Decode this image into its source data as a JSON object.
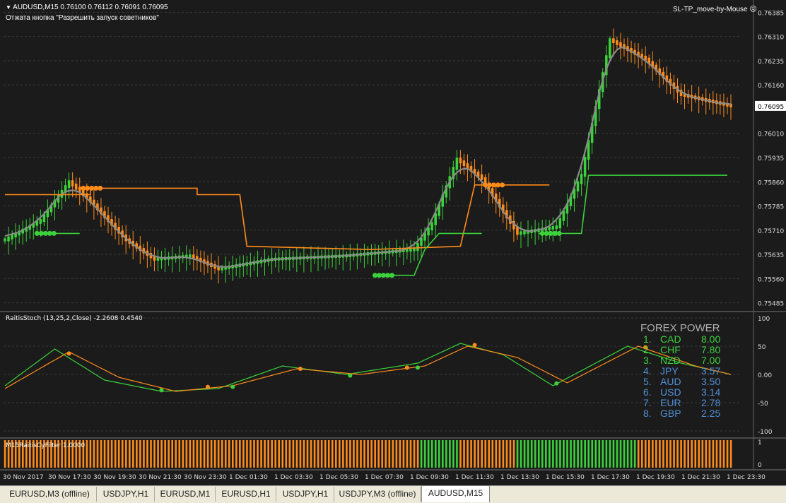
{
  "header": {
    "symbol_line": "AUDUSD,M15  0.76100 0.76112 0.76091 0.76095",
    "notice": "Отжата кнопка \"Разрешить запуск советников\"",
    "expert_name": "SL-TP_move-by-Mouse"
  },
  "colors": {
    "bg": "#1b1b1b",
    "grid": "#3a3a3a",
    "bull": "#3bd23b",
    "bear": "#ff8c1a",
    "ma": "#8a8a8a",
    "forex_title": "#b0b0b0",
    "rank_green": "#3bd23b",
    "rank_blue": "#4f8fd6"
  },
  "chart_data": [
    {
      "type": "candlestick",
      "name": "AUDUSD,M15",
      "ylim": [
        0.7546,
        0.7641
      ],
      "y_ticks": [
        "0.76385",
        "0.76310",
        "0.76235",
        "0.76160",
        "0.76095",
        "0.76010",
        "0.75935",
        "0.75860",
        "0.75785",
        "0.75710",
        "0.75635",
        "0.75560",
        "0.75485"
      ],
      "current_price": "0.76095",
      "bars": 205,
      "key_closes": [
        [
          0,
          0.7568
        ],
        [
          10,
          0.7574
        ],
        [
          18,
          0.7586
        ],
        [
          24,
          0.758
        ],
        [
          34,
          0.7568
        ],
        [
          42,
          0.7562
        ],
        [
          52,
          0.7563
        ],
        [
          60,
          0.7559
        ],
        [
          75,
          0.7562
        ],
        [
          95,
          0.7563
        ],
        [
          115,
          0.7565
        ],
        [
          120,
          0.7573
        ],
        [
          127,
          0.7593
        ],
        [
          134,
          0.7587
        ],
        [
          144,
          0.757
        ],
        [
          155,
          0.7572
        ],
        [
          162,
          0.7588
        ],
        [
          170,
          0.763
        ],
        [
          180,
          0.7624
        ],
        [
          190,
          0.7613
        ],
        [
          204,
          0.76095
        ]
      ],
      "resistance_line": [
        [
          0,
          0.7582
        ],
        [
          24,
          0.7582
        ],
        [
          24,
          0.7584
        ],
        [
          54,
          0.7584
        ],
        [
          54,
          0.7582
        ],
        [
          66,
          0.7582
        ],
        [
          68,
          0.7566
        ],
        [
          103,
          0.7565
        ],
        [
          128,
          0.7566
        ],
        [
          132,
          0.7585
        ],
        [
          153,
          0.7585
        ]
      ],
      "support_line": [
        [
          9,
          0.757
        ],
        [
          21,
          0.757
        ]
      ],
      "support_line_2": [
        [
          105,
          0.7557
        ],
        [
          115,
          0.7557
        ],
        [
          118,
          0.7565
        ],
        [
          122,
          0.757
        ],
        [
          134,
          0.757
        ]
      ],
      "support_line_3": [
        [
          150,
          0.757
        ],
        [
          162,
          0.757
        ],
        [
          164,
          0.7588
        ],
        [
          203,
          0.7588
        ]
      ]
    },
    {
      "type": "line",
      "title": "RaitisStoch (13,25,2,Close) -2.2608 0.4540",
      "ylim": [
        -110,
        110
      ],
      "y_ticks": [
        "100",
        "50",
        "0.00",
        "-50",
        "-100"
      ],
      "series": [
        {
          "name": "green",
          "points": [
            [
              0,
              -20
            ],
            [
              14,
              45
            ],
            [
              28,
              -10
            ],
            [
              44,
              -30
            ],
            [
              60,
              -25
            ],
            [
              78,
              15
            ],
            [
              96,
              0
            ],
            [
              116,
              20
            ],
            [
              128,
              55
            ],
            [
              140,
              35
            ],
            [
              154,
              -20
            ],
            [
              175,
              50
            ],
            [
              190,
              20
            ],
            [
              204,
              0
            ]
          ]
        },
        {
          "name": "orange",
          "points": [
            [
              0,
              -25
            ],
            [
              18,
              40
            ],
            [
              32,
              -5
            ],
            [
              48,
              -30
            ],
            [
              64,
              -20
            ],
            [
              82,
              10
            ],
            [
              100,
              0
            ],
            [
              118,
              15
            ],
            [
              130,
              50
            ],
            [
              144,
              30
            ],
            [
              158,
              -15
            ],
            [
              178,
              50
            ],
            [
              194,
              15
            ],
            [
              204,
              0
            ]
          ]
        }
      ],
      "markers": [
        {
          "x": 18,
          "y": 37,
          "color": "orange"
        },
        {
          "x": 44,
          "y": -28,
          "color": "green"
        },
        {
          "x": 57,
          "y": -22,
          "color": "orange"
        },
        {
          "x": 64,
          "y": -22,
          "color": "green"
        },
        {
          "x": 83,
          "y": 10,
          "color": "orange"
        },
        {
          "x": 97,
          "y": -2,
          "color": "green"
        },
        {
          "x": 113,
          "y": 12,
          "color": "orange"
        },
        {
          "x": 116,
          "y": 12,
          "color": "green"
        },
        {
          "x": 132,
          "y": 52,
          "color": "orange"
        },
        {
          "x": 155,
          "y": -16,
          "color": "green"
        },
        {
          "x": 180,
          "y": 48,
          "color": "orange"
        }
      ]
    },
    {
      "type": "bar",
      "title": "M15RaitisCyFilter 1.0000",
      "ylim": [
        0,
        1
      ],
      "y_ticks": [
        "1",
        "0"
      ],
      "green_ranges": [
        [
          117,
          127
        ],
        [
          144,
          177
        ]
      ]
    }
  ],
  "x_axis": {
    "labels": [
      "30 Nov 2017",
      "30 Nov 17:30",
      "30 Nov 19:30",
      "30 Nov 21:30",
      "30 Nov 23:30",
      "1 Dec 01:30",
      "1 Dec 03:30",
      "1 Dec 05:30",
      "1 Dec 07:30",
      "1 Dec 09:30",
      "1 Dec 11:30",
      "1 Dec 13:30",
      "1 Dec 15:30",
      "1 Dec 17:30",
      "1 Dec 19:30",
      "1 Dec 21:30",
      "1 Dec 23:30"
    ]
  },
  "forex_power": {
    "title": "FOREX POWER",
    "rows": [
      {
        "rank": "1.",
        "cur": "CAD",
        "val": "8.00",
        "group": "green"
      },
      {
        "rank": "2.",
        "cur": "CHF",
        "val": "7.80",
        "group": "green"
      },
      {
        "rank": "3.",
        "cur": "NZD",
        "val": "7.00",
        "group": "green"
      },
      {
        "rank": "4.",
        "cur": "JPY",
        "val": "3.57",
        "group": "blue"
      },
      {
        "rank": "5.",
        "cur": "AUD",
        "val": "3.50",
        "group": "blue"
      },
      {
        "rank": "6.",
        "cur": "USD",
        "val": "3.14",
        "group": "blue"
      },
      {
        "rank": "7.",
        "cur": "EUR",
        "val": "2.78",
        "group": "blue"
      },
      {
        "rank": "8.",
        "cur": "GBP",
        "val": "2.25",
        "group": "blue"
      }
    ]
  },
  "tabs": [
    {
      "label": "EURUSD,M3 (offline)",
      "active": false
    },
    {
      "label": "USDJPY,H1",
      "active": false
    },
    {
      "label": "EURUSD,M1",
      "active": false
    },
    {
      "label": "EURUSD,H1",
      "active": false
    },
    {
      "label": "USDJPY,H1",
      "active": false
    },
    {
      "label": "USDJPY,M3 (offline)",
      "active": false
    },
    {
      "label": "AUDUSD,M15",
      "active": true
    }
  ]
}
